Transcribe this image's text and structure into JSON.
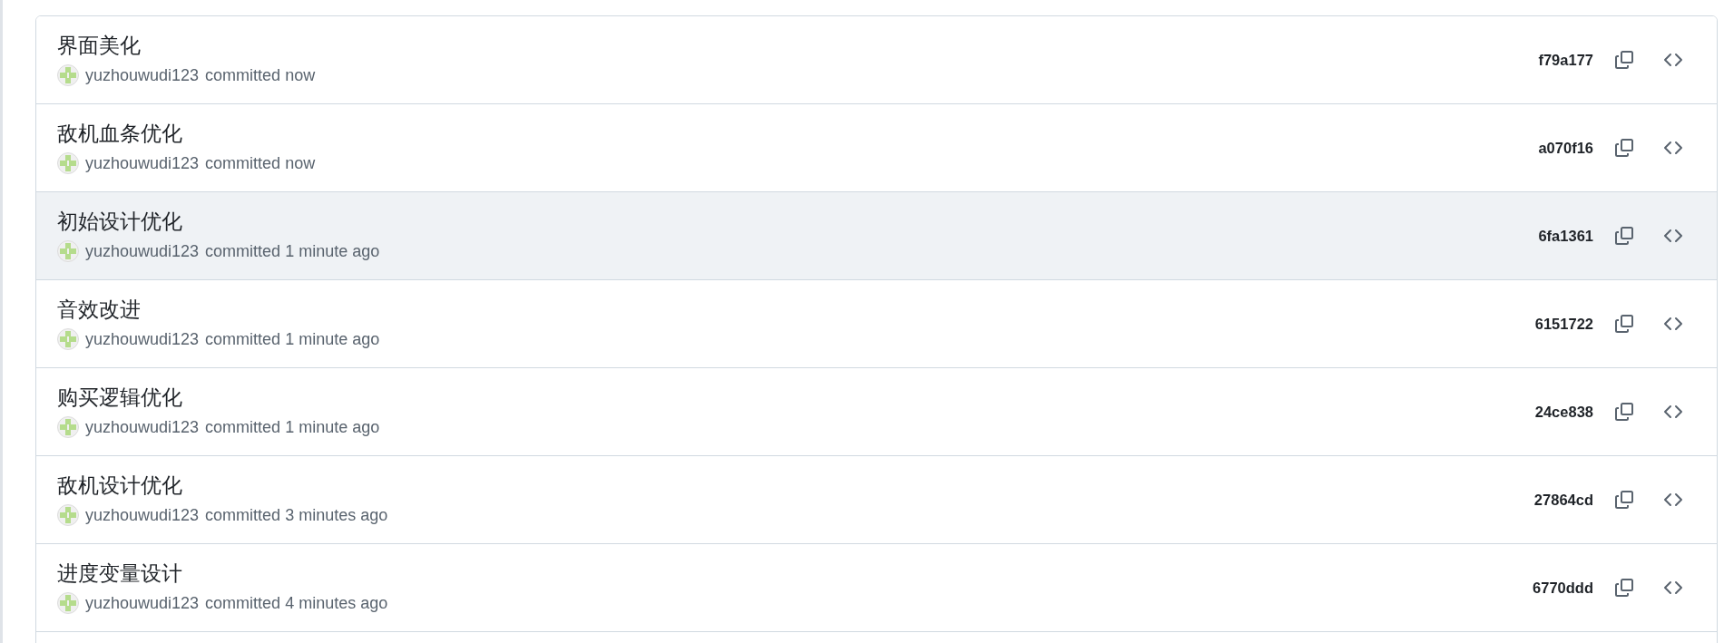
{
  "commits": [
    {
      "message": "界面美化",
      "author": "yuzhouwudi123",
      "action": "committed",
      "time": "now",
      "hash": "f79a177",
      "highlighted": false
    },
    {
      "message": "敌机血条优化",
      "author": "yuzhouwudi123",
      "action": "committed",
      "time": "now",
      "hash": "a070f16",
      "highlighted": false
    },
    {
      "message": "初始设计优化",
      "author": "yuzhouwudi123",
      "action": "committed",
      "time": "1 minute ago",
      "hash": "6fa1361",
      "highlighted": true
    },
    {
      "message": "音效改进",
      "author": "yuzhouwudi123",
      "action": "committed",
      "time": "1 minute ago",
      "hash": "6151722",
      "highlighted": false
    },
    {
      "message": "购买逻辑优化",
      "author": "yuzhouwudi123",
      "action": "committed",
      "time": "1 minute ago",
      "hash": "24ce838",
      "highlighted": false
    },
    {
      "message": "敌机设计优化",
      "author": "yuzhouwudi123",
      "action": "committed",
      "time": "3 minutes ago",
      "hash": "27864cd",
      "highlighted": false
    },
    {
      "message": "进度变量设计",
      "author": "yuzhouwudi123",
      "action": "committed",
      "time": "4 minutes ago",
      "hash": "6770ddd",
      "highlighted": false
    }
  ]
}
